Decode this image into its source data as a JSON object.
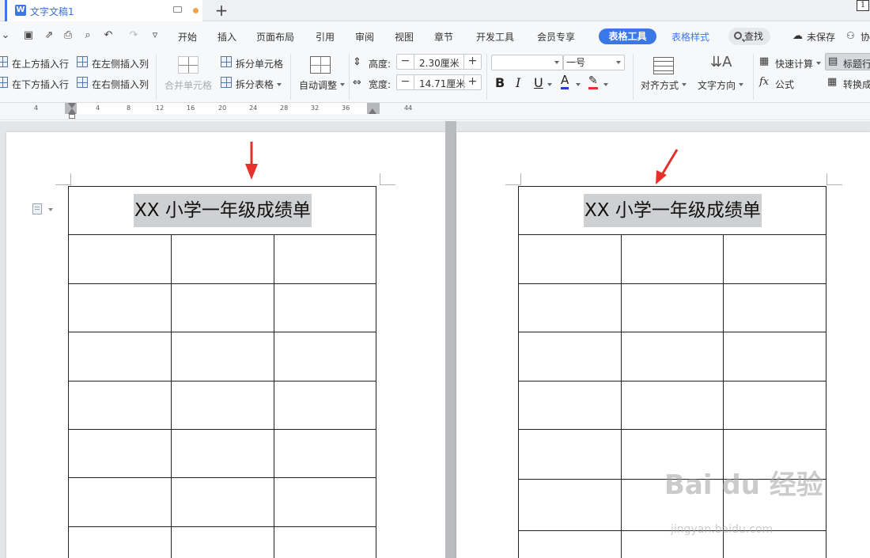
{
  "tab": {
    "title": "文字文稿1",
    "new_tab": "+",
    "page_box": "1"
  },
  "menu": {
    "items": [
      "开始",
      "插入",
      "页面布局",
      "引用",
      "审阅",
      "视图",
      "章节",
      "开发工具",
      "会员专享"
    ],
    "active": "表格工具",
    "secondary": "表格样式",
    "search": "查找",
    "unsaved": "未保存",
    "collab": "协"
  },
  "ribbon": {
    "insert_above": "在上方插入行",
    "insert_below": "在下方插入行",
    "insert_left": "在左侧插入列",
    "insert_right": "在右侧插入列",
    "merge_cells": "合并单元格",
    "split_cells": "拆分单元格",
    "split_table": "拆分表格",
    "auto_fit": "自动调整",
    "height_label": "高度:",
    "height_value": "2.30厘米",
    "width_label": "宽度:",
    "width_value": "14.71厘米",
    "font_name": "",
    "font_size": "一号",
    "bold": "B",
    "italic": "I",
    "underline": "U",
    "font_color": "A",
    "align": "对齐方式",
    "text_direction": "文字方向",
    "quick_calc": "快速计算",
    "formula": "公式",
    "formula_icon": "fx",
    "title_row": "标题行",
    "convert": "转换成"
  },
  "ruler": {
    "ticks": [
      "4",
      "4",
      "8",
      "12",
      "16",
      "20",
      "24",
      "28",
      "32",
      "36",
      "44"
    ]
  },
  "document": {
    "table_title_left": "XX 小学一年级成绩单",
    "table_title_right": "XX 小学一年级成绩单"
  },
  "watermark": {
    "main": "Bai du 经验",
    "sub": "jingyan.baidu.com"
  },
  "colors": {
    "accent": "#3b78e7",
    "arrow": "#e8302a",
    "highlight": "#cfd0d2",
    "font_color_bar": "#1f3fcf",
    "highlight_bar": "#e8302a"
  }
}
